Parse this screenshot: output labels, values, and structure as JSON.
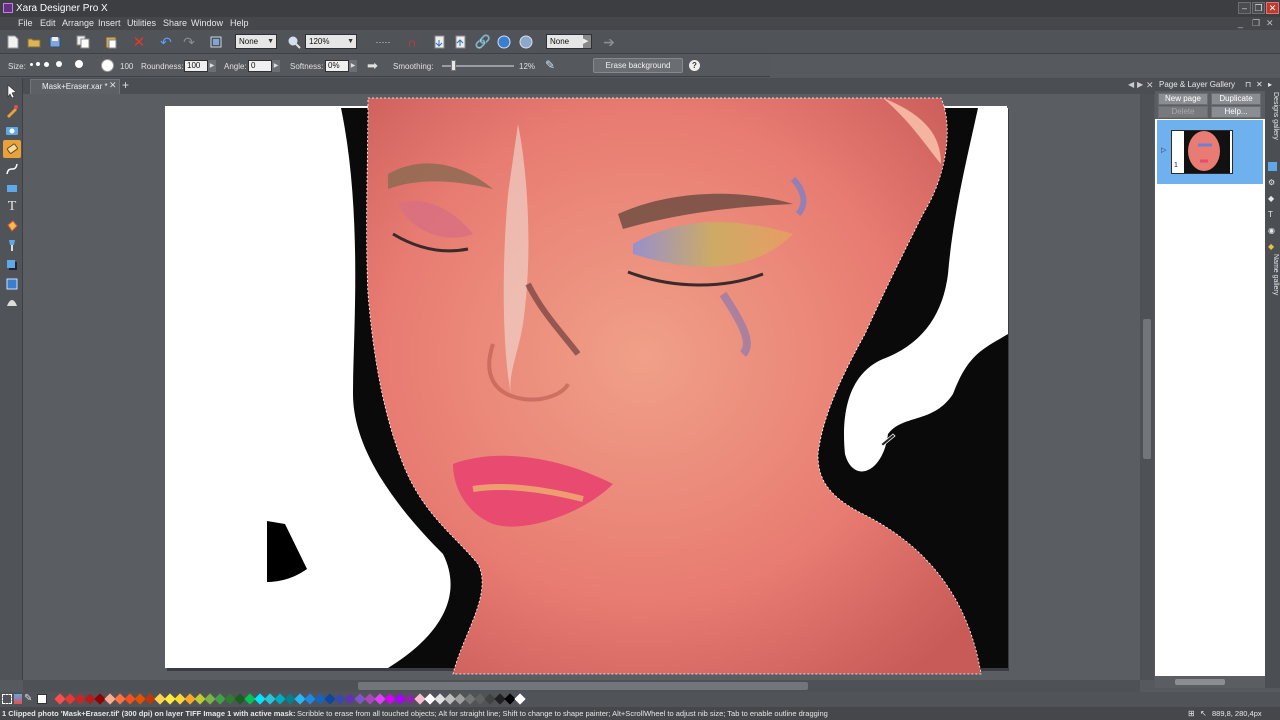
{
  "app": {
    "title": "Xara Designer Pro X"
  },
  "window_controls": {
    "minimize": "–",
    "restore": "❐",
    "close": "✕"
  },
  "menu": [
    "File",
    "Edit",
    "Arrange",
    "Insert",
    "Utilities",
    "Share",
    "Window",
    "Help"
  ],
  "toolbar": {
    "quality_select": "None",
    "zoom_select": "120%",
    "feather_select": "None"
  },
  "infobar": {
    "size_label": "Size:",
    "size_value": "100",
    "roundness_label": "Roundness:",
    "roundness_value": "100",
    "angle_label": "Angle:",
    "angle_value": "0",
    "softness_label": "Softness:",
    "softness_value": "0%",
    "smoothing_label": "Smoothing:",
    "smoothing_value": "12%",
    "smoothing_level": 0.12,
    "erase_background_label": "Erase background",
    "help_glyph": "?"
  },
  "document": {
    "tab_label": "Mask+Eraser.xar *",
    "add_tab_glyph": "+",
    "close_glyph": "✕"
  },
  "gallery": {
    "title": "Page & Layer Gallery",
    "new_page": "New page",
    "duplicate": "Duplicate",
    "delete": "Delete",
    "help": "Help...",
    "page_number": "1"
  },
  "side_tabs": [
    "Designs gallery",
    "Name gallery"
  ],
  "status": {
    "message_bold": "1 Clipped photo 'Mask+Eraser.tif' (300 dpi) on layer TIFF Image 1 with active mask:",
    "message": " Scribble to erase from all touched objects; Alt for straight line; Shift to change to shape painter; Alt+ScrollWheel to adjust nib size; Tab to enable outline dragging",
    "coords": "889,8, 280,4px"
  },
  "colors": {
    "accent_tool": "#e8a23a",
    "gallery_selected": "#6fb0ef",
    "palette": [
      "#ff4d4d",
      "#e53935",
      "#c62828",
      "#b71c1c",
      "#8e0000",
      "#ffab91",
      "#ff7043",
      "#f4511e",
      "#e65100",
      "#bf360c",
      "#ffd54f",
      "#ffeb3b",
      "#fdd835",
      "#f9a825",
      "#c0ca33",
      "#7cb342",
      "#43a047",
      "#2e7d32",
      "#1b5e20",
      "#00c853",
      "#00e5ff",
      "#26c6da",
      "#00acc1",
      "#00838f",
      "#29b6f6",
      "#1e88e5",
      "#1565c0",
      "#0d47a1",
      "#3949ab",
      "#5e35b1",
      "#7e57c2",
      "#ab47bc",
      "#e040fb",
      "#d500f9",
      "#aa00ff",
      "#8e24aa",
      "#f8bbd0",
      "#ffffff",
      "#e0e0e0",
      "#bdbdbd",
      "#9e9e9e",
      "#757575",
      "#616161",
      "#424242",
      "#212121",
      "#000000",
      "#ffffff"
    ]
  }
}
